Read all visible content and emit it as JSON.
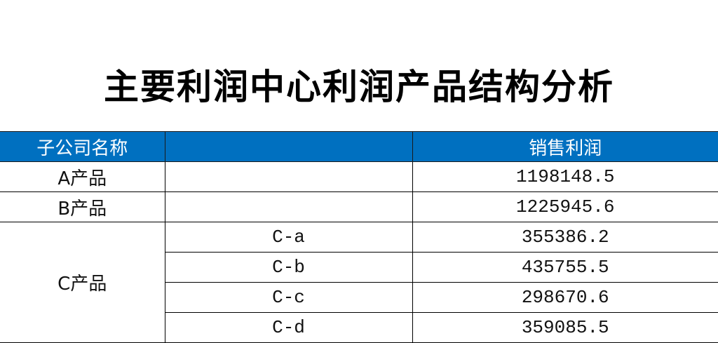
{
  "title": "主要利润中心利润产品结构分析",
  "table": {
    "headers": [
      "子公司名称",
      "",
      "销售利润"
    ],
    "rows": [
      {
        "name": "A产品",
        "sub": "",
        "profit": "1198148.5"
      },
      {
        "name": "B产品",
        "sub": "",
        "profit": "1225945.6"
      }
    ],
    "group": {
      "name": "C产品",
      "items": [
        {
          "sub": "C-a",
          "profit": "355386.2"
        },
        {
          "sub": "C-b",
          "profit": "435755.5"
        },
        {
          "sub": "C-c",
          "profit": "298670.6"
        },
        {
          "sub": "C-d",
          "profit": "359085.5"
        }
      ]
    }
  },
  "colors": {
    "header_bg": "#0070C0",
    "header_text": "#FFFFFF"
  }
}
